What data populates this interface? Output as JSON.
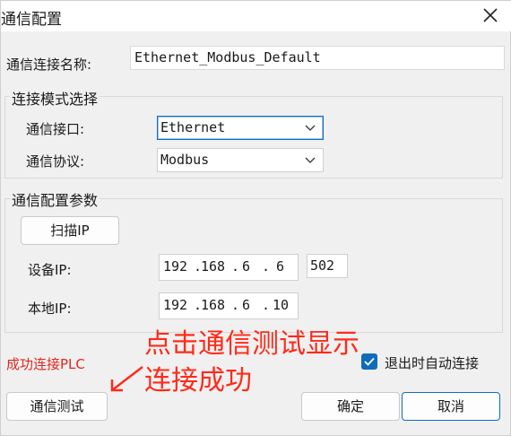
{
  "dialog": {
    "title": "通信配置",
    "close_icon": "close-icon"
  },
  "connection_name": {
    "label": "通信连接名称:",
    "value": "Ethernet_Modbus_Default"
  },
  "mode_group": {
    "title": "连接模式选择",
    "interface_label": "通信接口:",
    "interface_value": "Ethernet",
    "protocol_label": "通信协议:",
    "protocol_value": "Modbus"
  },
  "params_group": {
    "title": "通信配置参数",
    "scan_button": "扫描IP",
    "device_ip_label": "设备IP:",
    "device_ip": [
      "192",
      "168",
      "6",
      "6"
    ],
    "port": "502",
    "local_ip_label": "本地IP:",
    "local_ip": [
      "192",
      "168",
      "6",
      "10"
    ]
  },
  "status_text": "成功连接PLC",
  "annotation": {
    "line1": "点击通信测试显示",
    "line2": "连接成功",
    "color": "#ff2a1a"
  },
  "auto_connect": {
    "label": "退出时自动连接",
    "checked": true
  },
  "buttons": {
    "test": "通信测试",
    "ok": "确定",
    "cancel": "取消"
  },
  "colors": {
    "accent": "#0f6cbd",
    "status_red": "#e0271e"
  }
}
